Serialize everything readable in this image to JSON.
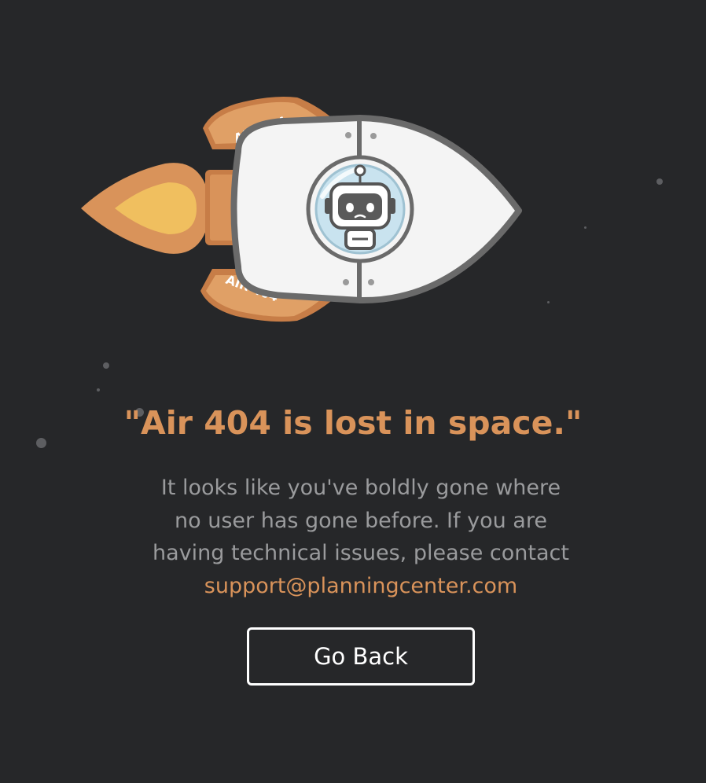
{
  "illustration": {
    "fin_top_label": "AIR 404",
    "fin_bottom_label": "AIR 404",
    "icons": [
      "rocket-icon",
      "robot-icon",
      "flame-icon",
      "star-icon"
    ]
  },
  "heading": "\"Air 404 is lost in space.\"",
  "message": {
    "line1": "It looks like you've boldly gone where",
    "line2": "no user has gone before. If you are",
    "line3": "having technical issues, please contact",
    "email": "support@planningcenter.com"
  },
  "go_back_label": "Go Back",
  "colors": {
    "background": "#262729",
    "accent": "#d9935a",
    "body_text": "#9a9b9d",
    "button_border": "#ffffff"
  }
}
